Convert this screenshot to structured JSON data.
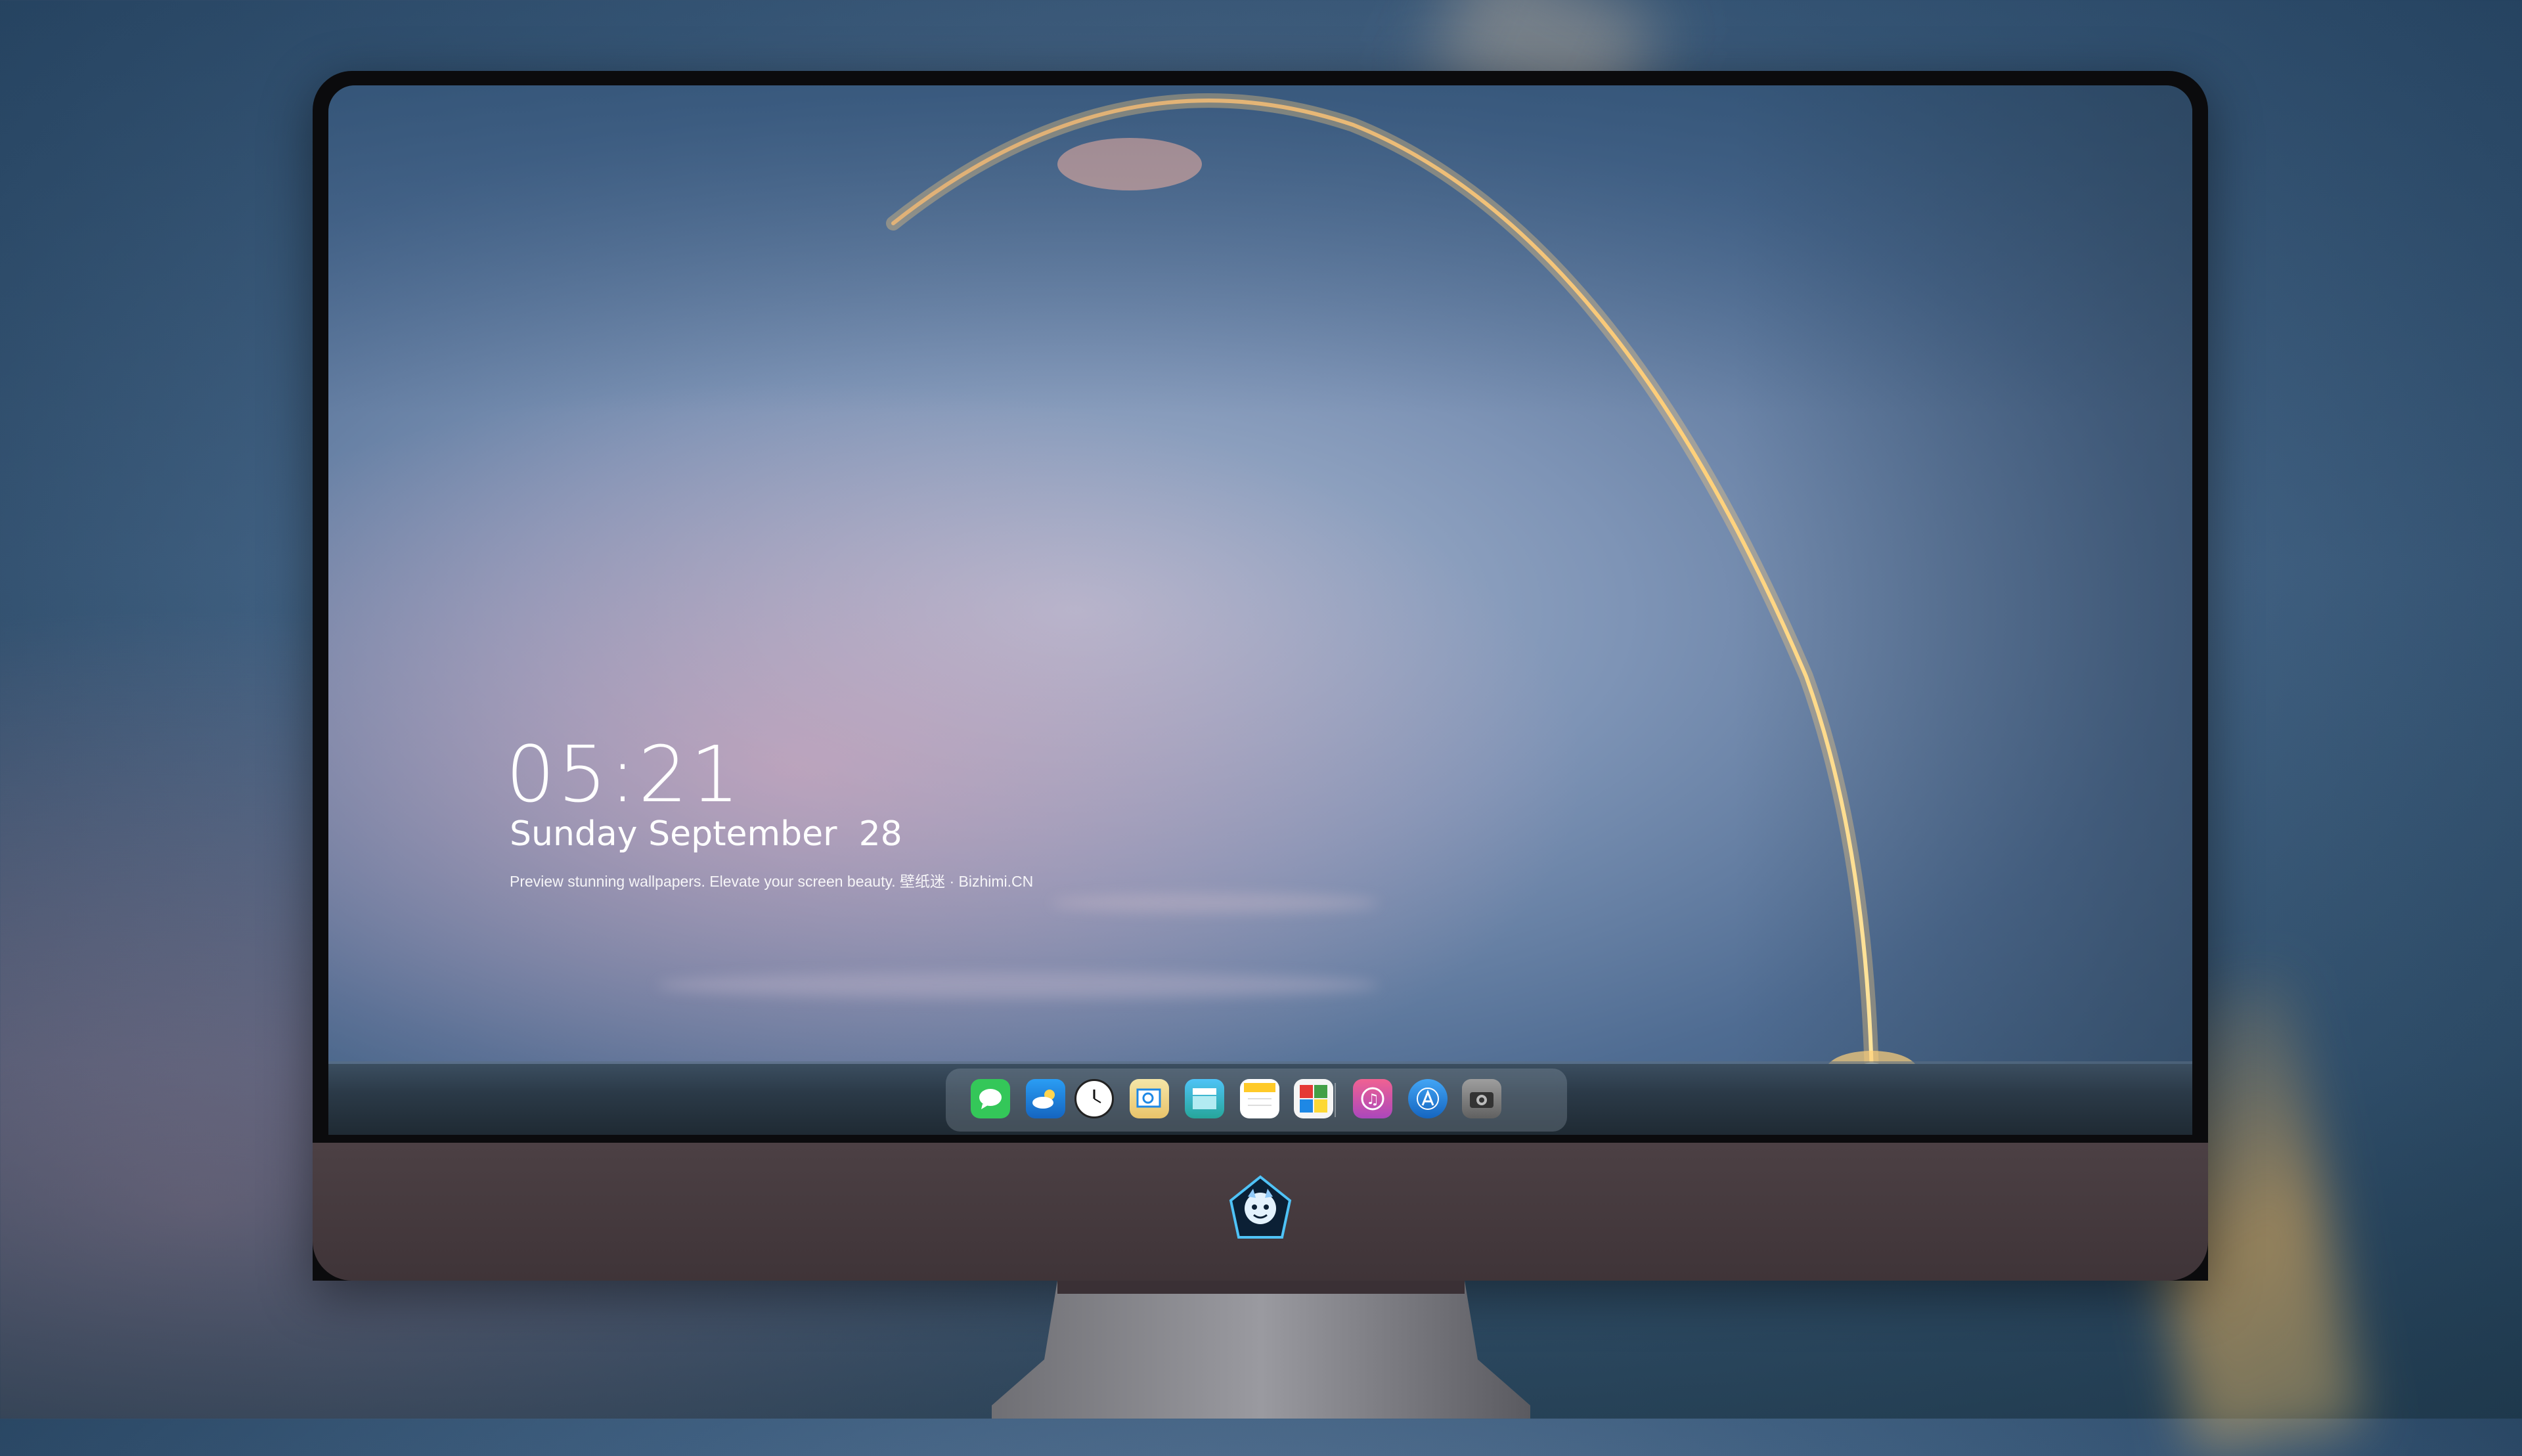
{
  "lockscreen": {
    "time": "05:21",
    "date": "Sunday September  28",
    "tagline": "Preview stunning wallpapers. Elevate your screen beauty. 壁纸迷 · Bizhimi.CN"
  },
  "dock": {
    "apps": [
      {
        "name": "messages-icon",
        "color": "#34c759"
      },
      {
        "name": "weather-icon",
        "color": "#1e88e5"
      },
      {
        "name": "clock-icon",
        "color": "#ffffff"
      },
      {
        "name": "preview-icon",
        "color": "#f2c94c"
      },
      {
        "name": "clips-icon",
        "color": "#4fc3f7"
      },
      {
        "name": "notes-icon",
        "color": "#ffd54f"
      },
      {
        "name": "photo-booth-icon",
        "color": "#e0e0e0"
      },
      {
        "name": "itunes-icon",
        "color": "#e040fb"
      },
      {
        "name": "app-store-icon",
        "color": "#1e88e5"
      },
      {
        "name": "camera-icon",
        "color": "#9e9e9e"
      }
    ]
  }
}
